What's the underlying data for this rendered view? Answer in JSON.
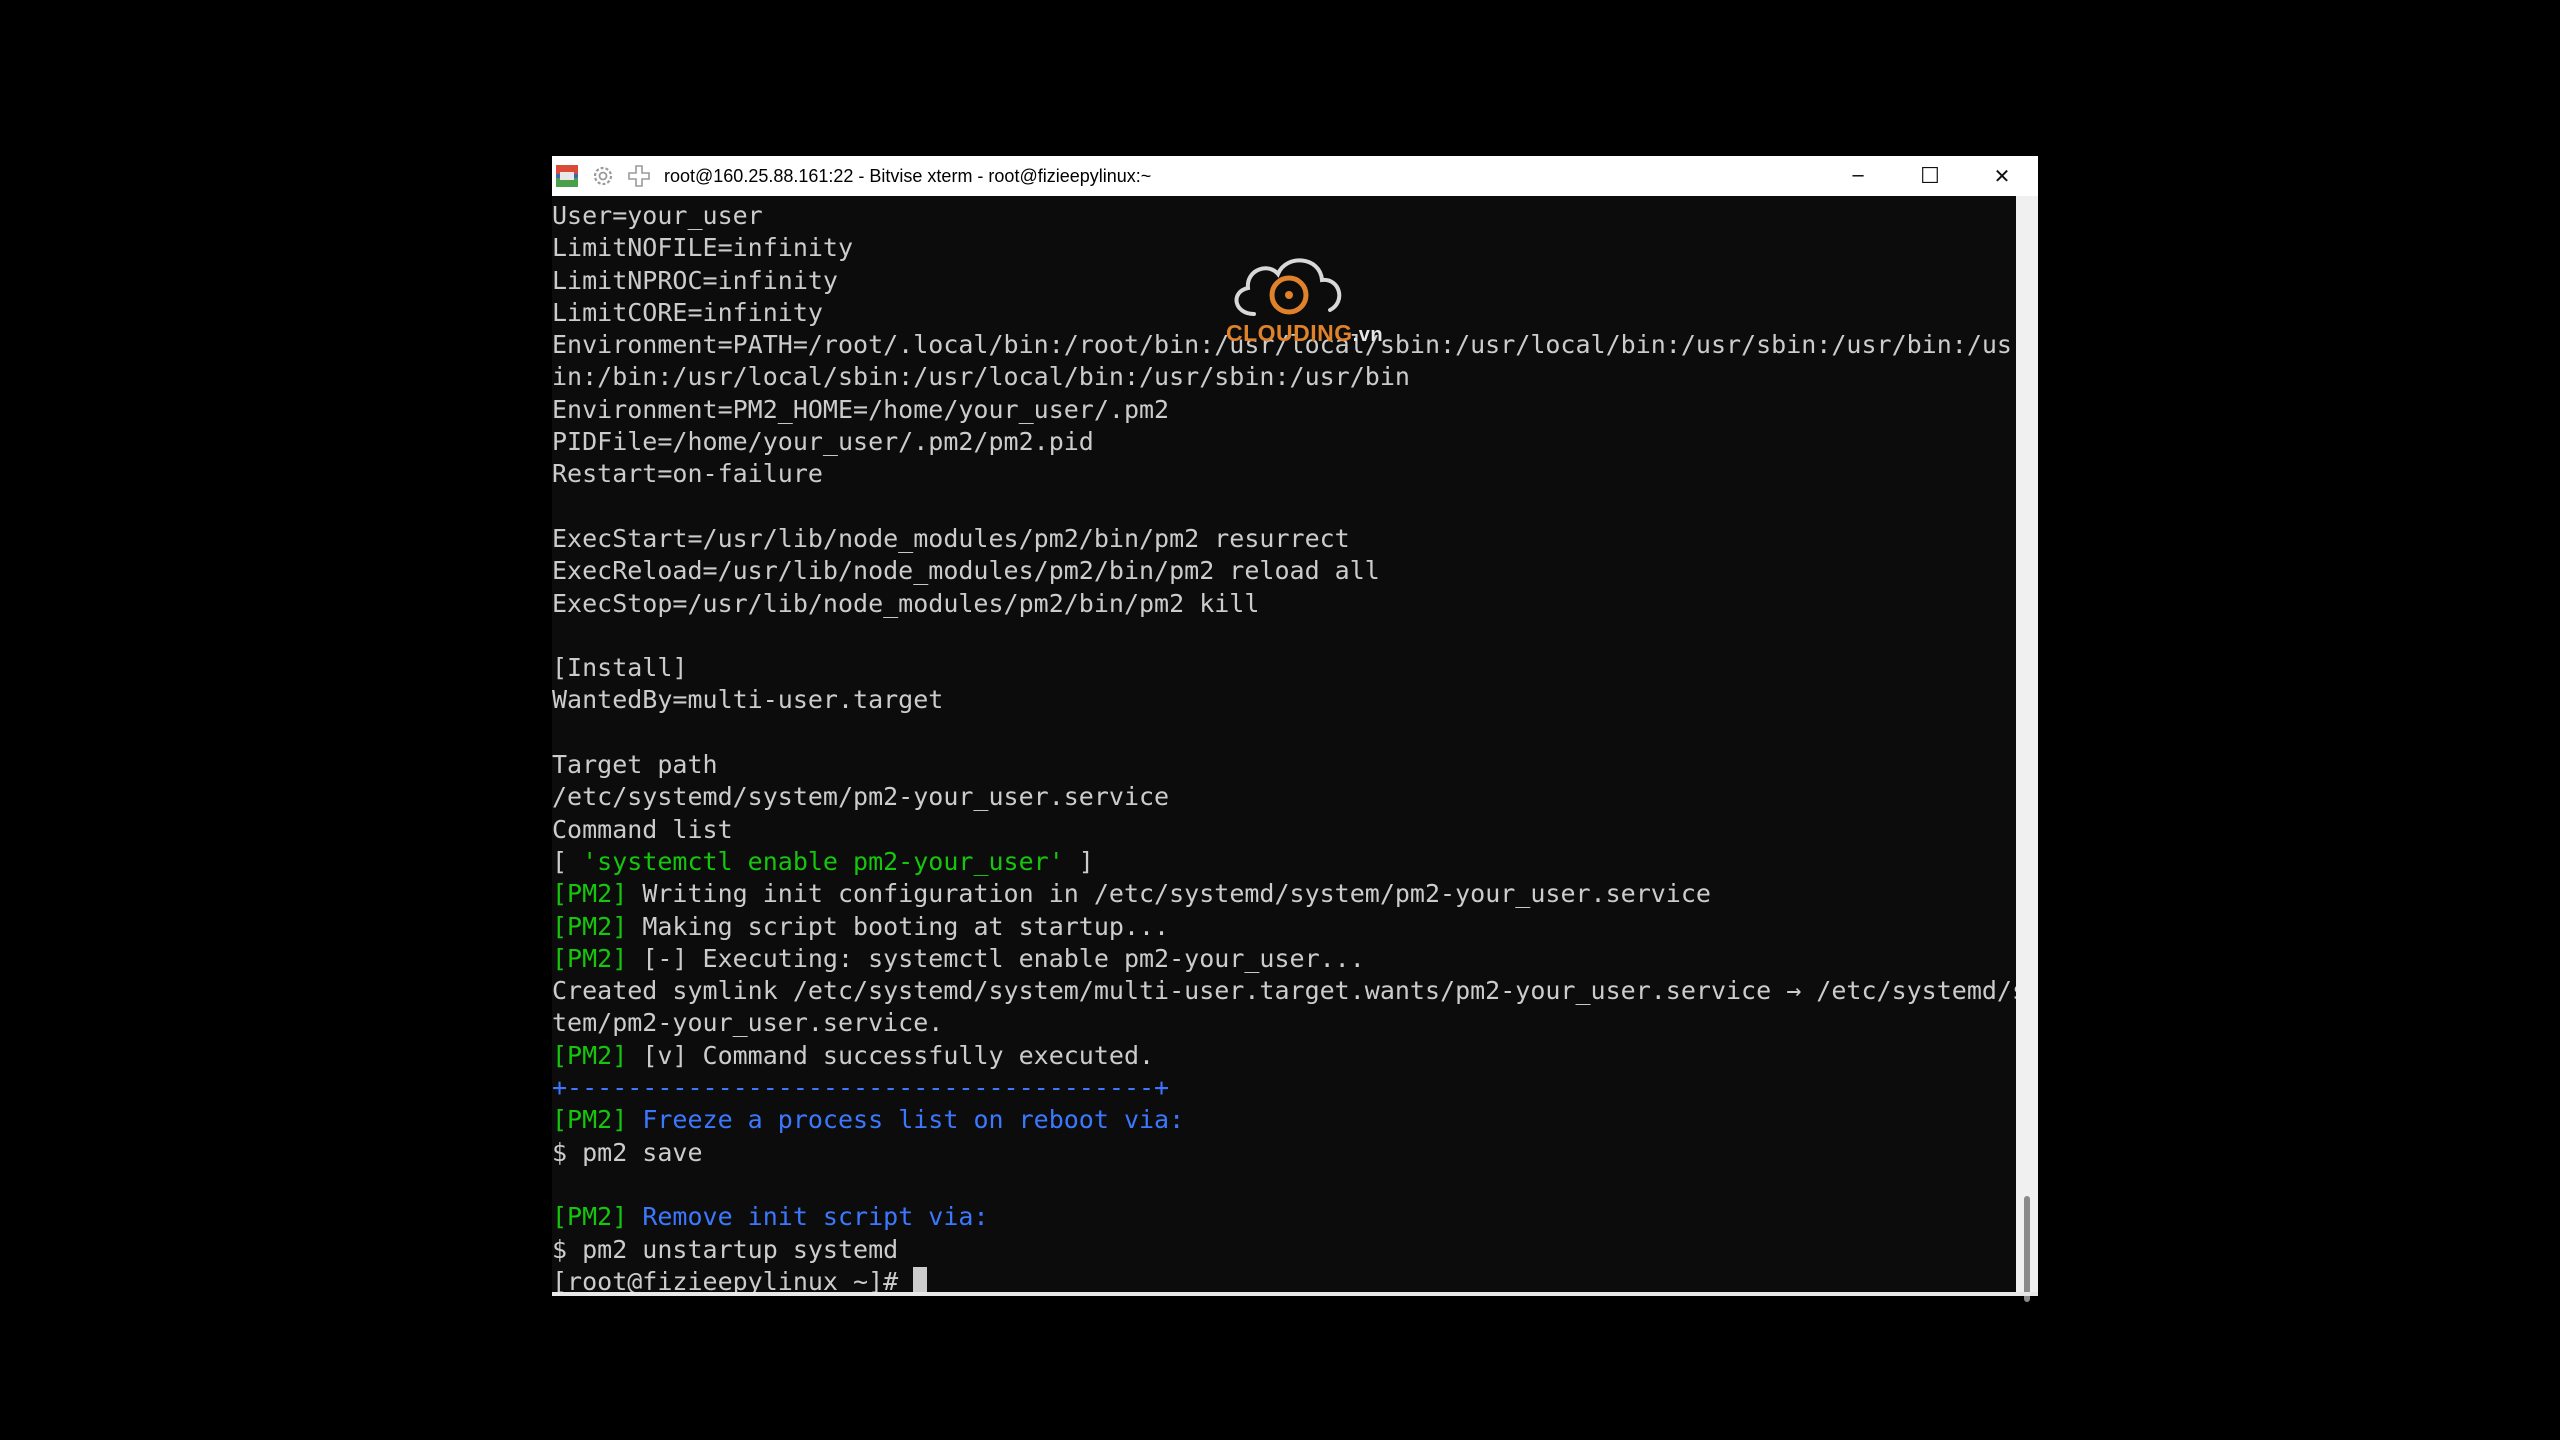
{
  "window": {
    "title": "root@160.25.88.161:22 - Bitvise xterm - root@fizieepylinux:~",
    "controls": {
      "minimize": "─",
      "maximize": "☐",
      "close": "✕"
    }
  },
  "watermark": {
    "brand": "CLOUDING",
    "suffix": ".vn"
  },
  "terminal": {
    "lines": [
      [
        {
          "t": "User=your_user",
          "c": ""
        }
      ],
      [
        {
          "t": "LimitNOFILE=infinity",
          "c": ""
        }
      ],
      [
        {
          "t": "LimitNPROC=infinity",
          "c": ""
        }
      ],
      [
        {
          "t": "LimitCORE=infinity",
          "c": ""
        }
      ],
      [
        {
          "t": "Environment=PATH=/root/.local/bin:/root/bin:/usr/local/sbin:/usr/local/bin:/usr/sbin:/usr/bin:/usr/b",
          "c": ""
        }
      ],
      [
        {
          "t": "in:/bin:/usr/local/sbin:/usr/local/bin:/usr/sbin:/usr/bin",
          "c": ""
        }
      ],
      [
        {
          "t": "Environment=PM2_HOME=/home/your_user/.pm2",
          "c": ""
        }
      ],
      [
        {
          "t": "PIDFile=/home/your_user/.pm2/pm2.pid",
          "c": ""
        }
      ],
      [
        {
          "t": "Restart=on-failure",
          "c": ""
        }
      ],
      [],
      [
        {
          "t": "ExecStart=/usr/lib/node_modules/pm2/bin/pm2 resurrect",
          "c": ""
        }
      ],
      [
        {
          "t": "ExecReload=/usr/lib/node_modules/pm2/bin/pm2 reload all",
          "c": ""
        }
      ],
      [
        {
          "t": "ExecStop=/usr/lib/node_modules/pm2/bin/pm2 kill",
          "c": ""
        }
      ],
      [],
      [
        {
          "t": "[Install]",
          "c": ""
        }
      ],
      [
        {
          "t": "WantedBy=multi-user.target",
          "c": ""
        }
      ],
      [],
      [
        {
          "t": "Target path",
          "c": ""
        }
      ],
      [
        {
          "t": "/etc/systemd/system/pm2-your_user.service",
          "c": ""
        }
      ],
      [
        {
          "t": "Command list",
          "c": ""
        }
      ],
      [
        {
          "t": "[ ",
          "c": ""
        },
        {
          "t": "'systemctl enable pm2-your_user'",
          "c": "g"
        },
        {
          "t": " ]",
          "c": ""
        }
      ],
      [
        {
          "t": "[PM2]",
          "c": "g"
        },
        {
          "t": " Writing init configuration in /etc/systemd/system/pm2-your_user.service",
          "c": ""
        }
      ],
      [
        {
          "t": "[PM2]",
          "c": "g"
        },
        {
          "t": " Making script booting at startup...",
          "c": ""
        }
      ],
      [
        {
          "t": "[PM2]",
          "c": "g"
        },
        {
          "t": " [-] Executing: systemctl enable pm2-your_user...",
          "c": ""
        }
      ],
      [
        {
          "t": "Created symlink /etc/systemd/system/multi-user.target.wants/pm2-your_user.service → /etc/systemd/sys",
          "c": ""
        }
      ],
      [
        {
          "t": "tem/pm2-your_user.service.",
          "c": ""
        }
      ],
      [
        {
          "t": "[PM2]",
          "c": "g"
        },
        {
          "t": " [v] Command successfully executed.",
          "c": ""
        }
      ],
      [
        {
          "t": "+---------------------------------------+",
          "c": "b"
        }
      ],
      [
        {
          "t": "[PM2]",
          "c": "g"
        },
        {
          "t": " Freeze a process list on reboot via:",
          "c": "b"
        }
      ],
      [
        {
          "t": "$ pm2 save",
          "c": ""
        }
      ],
      [],
      [
        {
          "t": "[PM2]",
          "c": "g"
        },
        {
          "t": " Remove init script via:",
          "c": "b"
        }
      ],
      [
        {
          "t": "$ pm2 unstartup systemd",
          "c": ""
        }
      ],
      [
        {
          "t": "[root@fizieepylinux ~]# ",
          "c": ""
        }
      ]
    ]
  },
  "colors": {
    "terminal_bg": "#0c0c0c",
    "text": "#cccccc",
    "green": "#16c60c",
    "blue": "#3b78ff",
    "brand_orange": "#e0822a"
  }
}
